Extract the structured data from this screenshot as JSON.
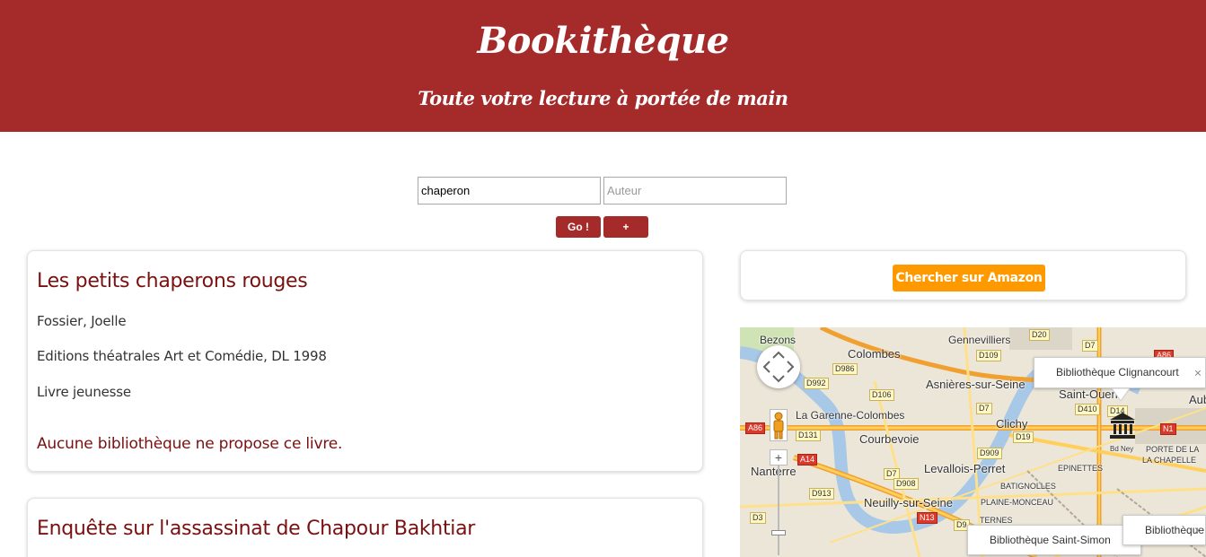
{
  "header": {
    "title": "Bookithèque",
    "subtitle": "Toute votre lecture à portée de main"
  },
  "search": {
    "title_value": "chaperon",
    "author_placeholder": "Auteur",
    "go_label": "Go !",
    "add_label": "+"
  },
  "results": [
    {
      "title": "Les petits chaperons rouges",
      "author": "Fossier, Joelle",
      "publisher": "Editions théatrales Art et Comédie, DL 1998",
      "category": "Livre jeunesse",
      "availability": "Aucune bibliothèque ne propose ce livre."
    },
    {
      "title": "Enquête sur l'assassinat de Chapour Bakhtiar"
    }
  ],
  "amazon": {
    "label": "Chercher sur Amazon",
    "color": "#ff9900"
  },
  "colors": {
    "brand": "#a52a2a",
    "book_title": "#7a1010"
  },
  "map": {
    "places": [
      "Bezons",
      "Gennevilliers",
      "Colombes",
      "Asnières-sur-Seine",
      "Saint-Ouen",
      "La Garenne-Colombes",
      "Clichy",
      "Courbevoie",
      "Levallois-Perret",
      "Nanterre",
      "Neuilly-sur-Seine",
      "Aub",
      "BATIGNOLLES",
      "PLAINE-MONCEAU",
      "EPINETTES",
      "PORTE DE LA",
      "LA CHAPELLE",
      "TERNES",
      "Bd Ney"
    ],
    "roads": [
      "D20",
      "D7",
      "A86",
      "D109",
      "D986",
      "D992",
      "D106",
      "D14",
      "D410",
      "N1",
      "A86",
      "D131",
      "D7",
      "D19",
      "A14",
      "D909",
      "D7",
      "D908",
      "D913",
      "N13",
      "D3",
      "D9"
    ],
    "infowindows": [
      {
        "label": "Bibliothèque Clignancourt"
      },
      {
        "label": "Bibliothèque Saint-Simon"
      },
      {
        "label": "Bibliothèque"
      }
    ],
    "icons": [
      "pan-control",
      "pegman",
      "zoom-slider",
      "library-marker"
    ]
  }
}
